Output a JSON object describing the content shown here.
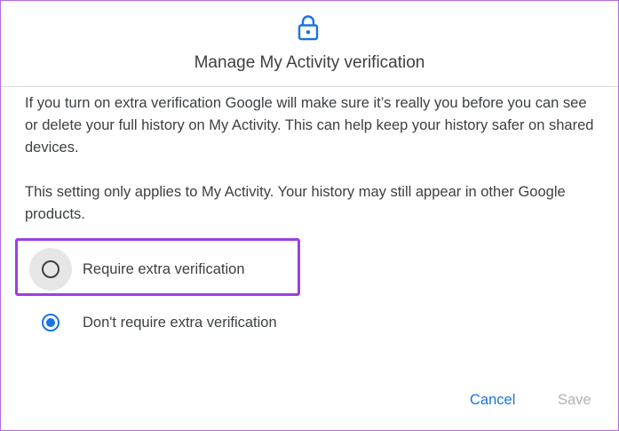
{
  "dialog": {
    "icon": "lock-icon",
    "title": "Manage My Activity verification",
    "paragraph1": "If you turn on extra verification Google will make sure it’s really you before you can see or delete your full history on My Activity. This can help keep your history safer on shared devices.",
    "paragraph2": "This setting only applies to My Activity. Your history may still appear in other Google products."
  },
  "options": [
    {
      "label": "Require extra verification",
      "selected": false,
      "highlighted": true
    },
    {
      "label": "Don't require extra verification",
      "selected": true,
      "highlighted": false
    }
  ],
  "actions": {
    "cancel_label": "Cancel",
    "save_label": "Save",
    "save_enabled": false
  },
  "colors": {
    "accent": "#1a73e8",
    "highlight_border": "#9c3fe0",
    "text": "#3c4043",
    "disabled_text": "#b0b3b7"
  }
}
